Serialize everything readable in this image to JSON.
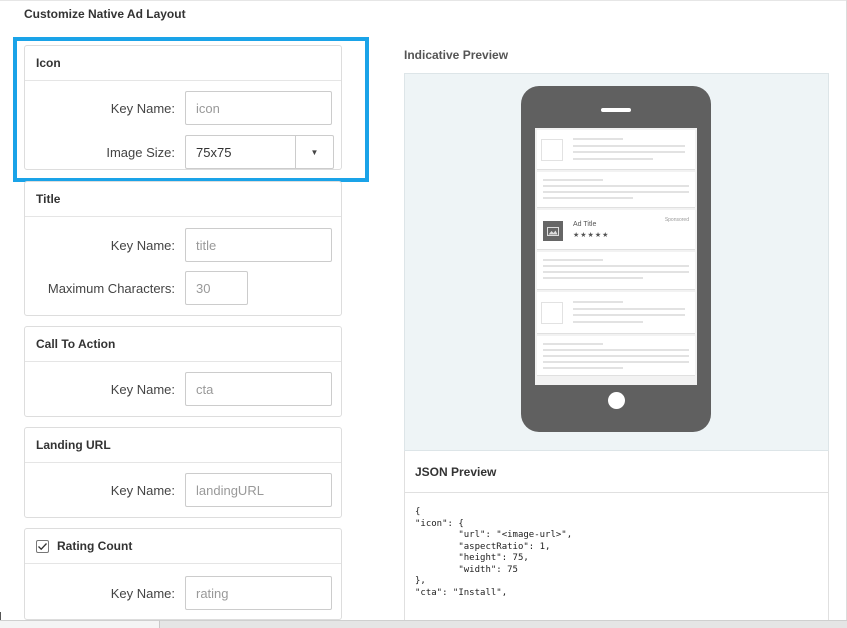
{
  "page_title": "Customize Native Ad Layout",
  "sections": {
    "icon": {
      "title": "Icon",
      "key_label": "Key Name:",
      "key_placeholder": "icon",
      "size_label": "Image Size:",
      "size_value": "75x75"
    },
    "title": {
      "title": "Title",
      "key_label": "Key Name:",
      "key_placeholder": "title",
      "maxchars_label": "Maximum Characters:",
      "maxchars_placeholder": "30"
    },
    "cta": {
      "title": "Call To Action",
      "key_label": "Key Name:",
      "key_placeholder": "cta"
    },
    "landing": {
      "title": "Landing URL",
      "key_label": "Key Name:",
      "key_placeholder": "landingURL"
    },
    "rating": {
      "title": "Rating Count",
      "checked": true,
      "key_label": "Key Name:",
      "key_placeholder": "rating"
    }
  },
  "preview": {
    "title": "Indicative Preview",
    "ad_title": "Ad Title",
    "stars": "★★★★★",
    "sponsored": "Sponsored"
  },
  "json_preview": {
    "title": "JSON Preview",
    "lines": [
      "{",
      "\"icon\": {",
      "        \"url\": \"<image-url>\",",
      "        \"aspectRatio\": 1,",
      "        \"height\": 75,",
      "        \"width\": 75",
      "},",
      "\"cta\": \"Install\","
    ]
  },
  "colors": {
    "highlight": "#1aa3e8",
    "phone": "#606060"
  }
}
